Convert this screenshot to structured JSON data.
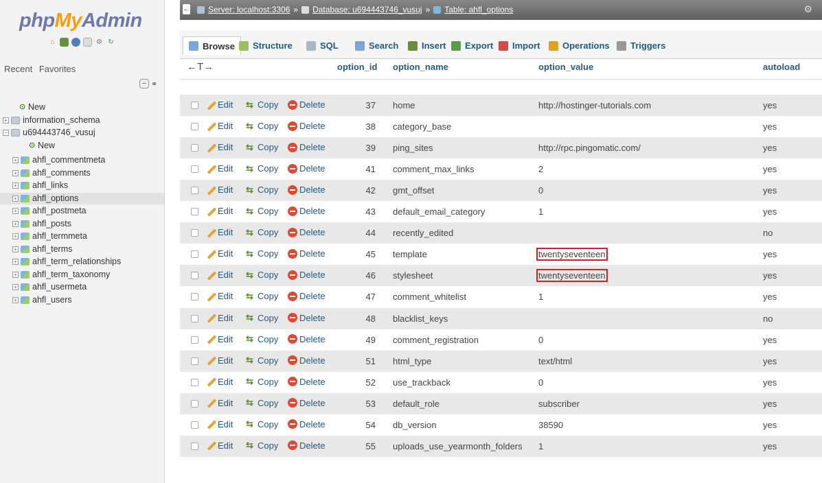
{
  "nav": {
    "logo": {
      "php": "php",
      "my": "My",
      "admin": "Admin"
    },
    "recent_label": "Recent",
    "favorites_label": "Favorites",
    "tree": [
      {
        "label": "New",
        "level": 1,
        "type": "new"
      },
      {
        "label": "information_schema",
        "level": 0,
        "type": "db"
      },
      {
        "label": "u694443746_vusuj",
        "level": 0,
        "type": "db",
        "expanded": true
      },
      {
        "label": "New",
        "level": 2,
        "type": "new"
      },
      {
        "label": "ahfl_commentmeta",
        "level": 1,
        "type": "table"
      },
      {
        "label": "ahfl_comments",
        "level": 1,
        "type": "table"
      },
      {
        "label": "ahfl_links",
        "level": 1,
        "type": "table"
      },
      {
        "label": "ahfl_options",
        "level": 1,
        "type": "table",
        "selected": true
      },
      {
        "label": "ahfl_postmeta",
        "level": 1,
        "type": "table"
      },
      {
        "label": "ahfl_posts",
        "level": 1,
        "type": "table"
      },
      {
        "label": "ahfl_termmeta",
        "level": 1,
        "type": "table"
      },
      {
        "label": "ahfl_terms",
        "level": 1,
        "type": "table"
      },
      {
        "label": "ahfl_term_relationships",
        "level": 1,
        "type": "table"
      },
      {
        "label": "ahfl_term_taxonomy",
        "level": 1,
        "type": "table"
      },
      {
        "label": "ahfl_usermeta",
        "level": 1,
        "type": "table"
      },
      {
        "label": "ahfl_users",
        "level": 1,
        "type": "table"
      }
    ]
  },
  "breadcrumb": {
    "server": "Server: localhost:3306",
    "database": "Database: u694443746_vusuj",
    "table": "Table: ahfl_options",
    "separator": "»"
  },
  "tabs": [
    {
      "label": "Browse",
      "icon": "browse-icon",
      "active": true
    },
    {
      "label": "Structure",
      "icon": "structure-icon"
    },
    {
      "label": "SQL",
      "icon": "sql-icon"
    },
    {
      "label": "Search",
      "icon": "search-icon"
    },
    {
      "label": "Insert",
      "icon": "insert-icon"
    },
    {
      "label": "Export",
      "icon": "export-icon"
    },
    {
      "label": "Import",
      "icon": "import-icon"
    },
    {
      "label": "Operations",
      "icon": "operations-icon"
    },
    {
      "label": "Triggers",
      "icon": "triggers-icon"
    }
  ],
  "table": {
    "headers": {
      "arrows": "←T→",
      "id": "option_id",
      "name": "option_name",
      "value": "option_value",
      "autoload": "autoload"
    },
    "action_labels": {
      "edit": "Edit",
      "copy": "Copy",
      "delete": "Delete"
    },
    "rows": [
      {
        "id": "37",
        "name": "home",
        "value": "http://hostinger-tutorials.com",
        "autoload": "yes"
      },
      {
        "id": "38",
        "name": "category_base",
        "value": "",
        "autoload": "yes"
      },
      {
        "id": "39",
        "name": "ping_sites",
        "value": "http://rpc.pingomatic.com/",
        "autoload": "yes"
      },
      {
        "id": "41",
        "name": "comment_max_links",
        "value": "2",
        "autoload": "yes"
      },
      {
        "id": "42",
        "name": "gmt_offset",
        "value": "0",
        "autoload": "yes"
      },
      {
        "id": "43",
        "name": "default_email_category",
        "value": "1",
        "autoload": "yes"
      },
      {
        "id": "44",
        "name": "recently_edited",
        "value": "",
        "autoload": "no"
      },
      {
        "id": "45",
        "name": "template",
        "value": "twentyseventeen",
        "autoload": "yes",
        "highlight": true
      },
      {
        "id": "46",
        "name": "stylesheet",
        "value": "twentyseventeen",
        "autoload": "yes",
        "highlight": true
      },
      {
        "id": "47",
        "name": "comment_whitelist",
        "value": "1",
        "autoload": "yes"
      },
      {
        "id": "48",
        "name": "blacklist_keys",
        "value": "",
        "autoload": "no"
      },
      {
        "id": "49",
        "name": "comment_registration",
        "value": "0",
        "autoload": "yes"
      },
      {
        "id": "51",
        "name": "html_type",
        "value": "text/html",
        "autoload": "yes"
      },
      {
        "id": "52",
        "name": "use_trackback",
        "value": "0",
        "autoload": "yes"
      },
      {
        "id": "53",
        "name": "default_role",
        "value": "subscriber",
        "autoload": "yes"
      },
      {
        "id": "54",
        "name": "db_version",
        "value": "38590",
        "autoload": "yes"
      },
      {
        "id": "55",
        "name": "uploads_use_yearmonth_folders",
        "value": "1",
        "autoload": "yes"
      }
    ]
  },
  "colors": {
    "link": "#235a81",
    "highlight_border": "#d42020",
    "even_row": "#e8e8e8"
  }
}
